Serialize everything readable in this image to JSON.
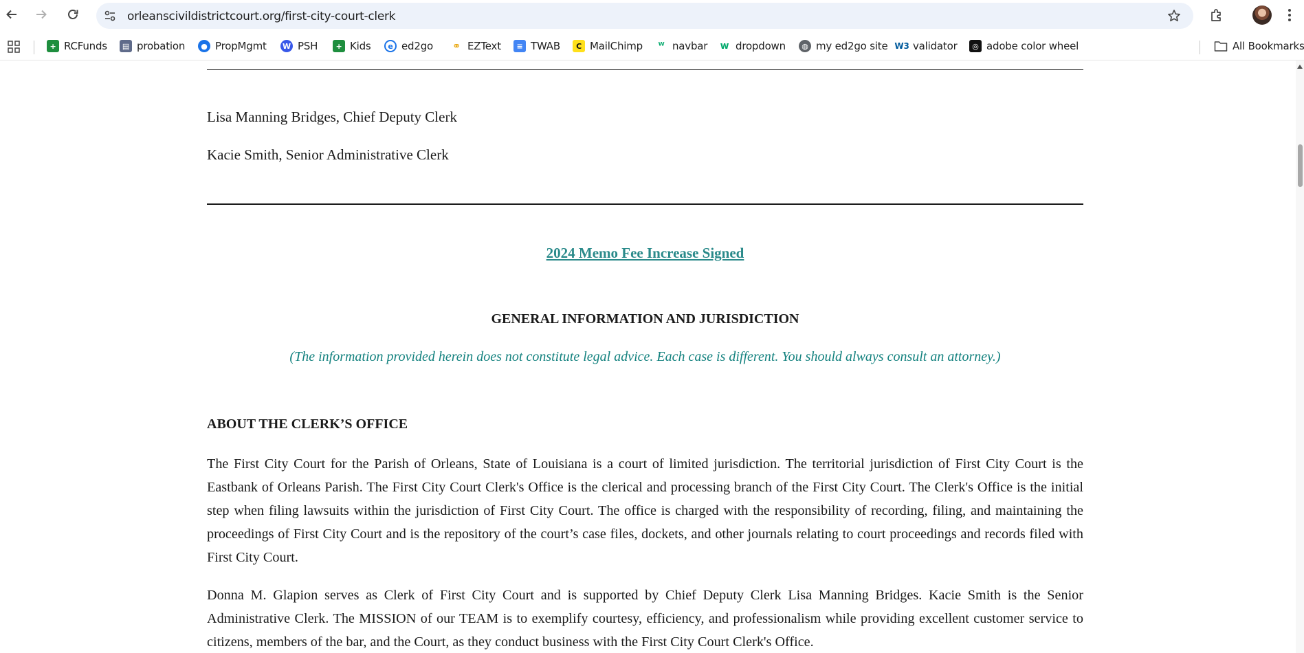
{
  "browser": {
    "url": "orleanscivildistrictcourt.org/first-city-court-clerk",
    "back_icon": "arrow-left-icon",
    "forward_icon": "arrow-right-icon",
    "reload_icon": "reload-icon",
    "bookmark_star_icon": "star-icon",
    "extensions_icon": "puzzle-icon",
    "menu_icon": "kebab-menu-icon"
  },
  "bookmarks": {
    "items": [
      {
        "label": "RCFunds",
        "icon": "sheets-icon",
        "color": "#1e8e3e"
      },
      {
        "label": "probation",
        "icon": "document-person-icon",
        "color": "#5f6b8a"
      },
      {
        "label": "PropMgmt",
        "icon": "person-globe-icon",
        "color": "#1a73e8"
      },
      {
        "label": "PSH",
        "icon": "wordpress-icon",
        "color": "#3858e9"
      },
      {
        "label": "Kids",
        "icon": "sheets-icon",
        "color": "#1e8e3e"
      },
      {
        "label": "ed2go",
        "icon": "ed2go-icon",
        "color": "#1a73e8"
      },
      {
        "label": "EZText",
        "icon": "eztext-icon",
        "color": "#e8a200"
      },
      {
        "label": "TWAB",
        "icon": "docs-icon",
        "color": "#4285f4"
      },
      {
        "label": "MailChimp",
        "icon": "mailchimp-icon",
        "color": "#ffe01b"
      },
      {
        "label": "navbar",
        "icon": "w3-icon",
        "color": "#04aa6d"
      },
      {
        "label": "dropdown",
        "icon": "w3-icon",
        "color": "#04aa6d"
      },
      {
        "label": "my ed2go site",
        "icon": "globe-icon",
        "color": "#5f6368"
      },
      {
        "label": "validator",
        "icon": "w3c-icon",
        "color": "#005a9c"
      },
      {
        "label": "adobe color wheel",
        "icon": "adobe-color-icon",
        "color": "#111111"
      }
    ],
    "all_bookmarks_label": "All Bookmarks"
  },
  "page": {
    "staff": [
      "Lisa Manning Bridges, Chief Deputy Clerk",
      "Kacie Smith, Senior Administrative Clerk"
    ],
    "memo_link": "2024 Memo Fee Increase Signed",
    "general_heading": "GENERAL INFORMATION AND JURISDICTION",
    "disclaimer": "(The information provided herein does not constitute legal advice. Each case is different. You should always consult an attorney.)",
    "about_heading": "ABOUT THE CLERK’S OFFICE",
    "paragraphs": [
      "The First City Court for the Parish of Orleans, State of Louisiana is a court of limited jurisdiction. The territorial jurisdiction of First City Court is the Eastbank of Orleans Parish.  The First City Court Clerk's Office is the clerical and processing branch of the First City Court.  The Clerk's Office is the initial step when filing lawsuits within the jurisdiction of First City Court.  The office is charged with the responsibility of recording, filing, and maintaining the proceedings of First City Court and is the repository of the court’s case files, dockets, and other journals relating to court proceedings and records filed with First City Court.",
      "Donna M. Glapion serves as Clerk of First City Court and is supported by Chief Deputy Clerk Lisa Manning Bridges. Kacie Smith is the Senior Administrative Clerk.  The MISSION of our TEAM is to exemplify courtesy, efficiency, and professionalism while providing excellent customer service to citizens, members of the bar, and the Court, as they conduct business with the First City Court Clerk's Office."
    ]
  },
  "colors": {
    "link": "#2a8a8a",
    "disclaimer": "#14827f",
    "omnibox_bg": "#edf2fa"
  }
}
